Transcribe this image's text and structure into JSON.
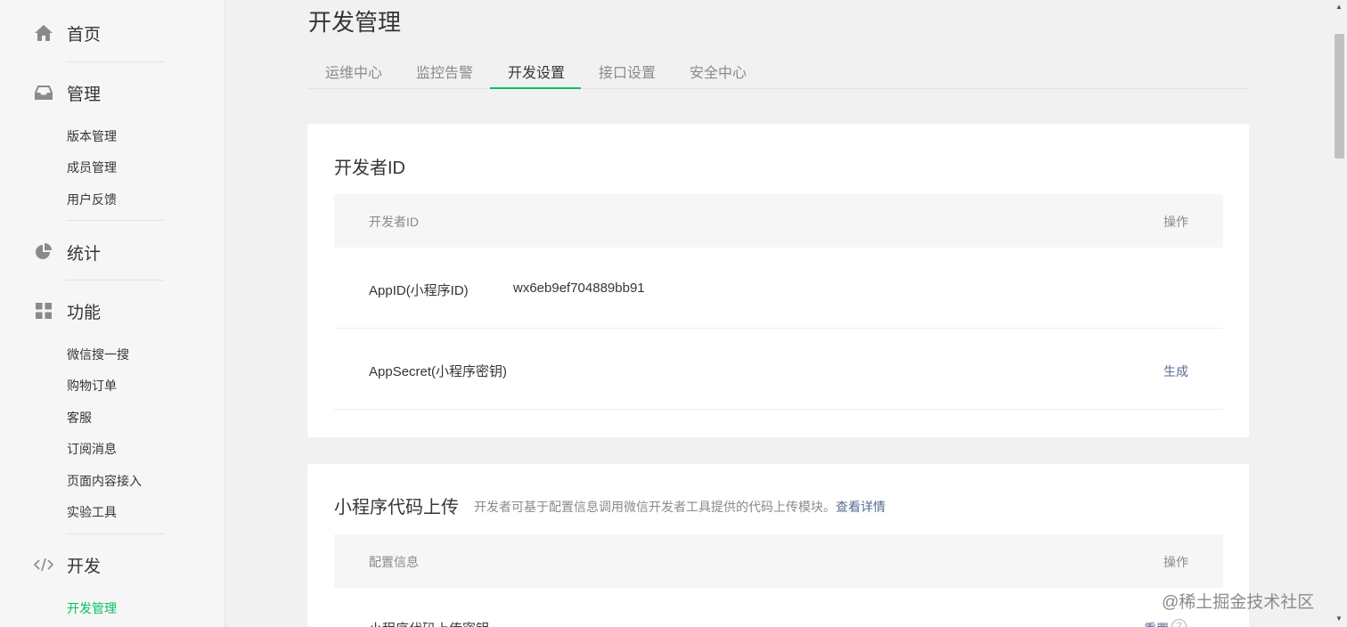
{
  "sidebar": {
    "home": "首页",
    "manage": "管理",
    "manage_items": [
      "版本管理",
      "成员管理",
      "用户反馈"
    ],
    "stats": "统计",
    "features": "功能",
    "feature_items": [
      "微信搜一搜",
      "购物订单",
      "客服",
      "订阅消息",
      "页面内容接入",
      "实验工具"
    ],
    "dev": "开发",
    "dev_items": [
      "开发管理"
    ]
  },
  "main": {
    "title": "开发管理",
    "tabs": [
      "运维中心",
      "监控告警",
      "开发设置",
      "接口设置",
      "安全中心"
    ],
    "active_tab": "开发设置",
    "developer_id": {
      "title": "开发者ID",
      "col_name": "开发者ID",
      "col_action": "操作",
      "rows": [
        {
          "label": "AppID(小程序ID)",
          "value": "wx6eb9ef704889bb91",
          "action": ""
        },
        {
          "label": "AppSecret(小程序密钥)",
          "value": "",
          "action": "生成"
        }
      ]
    },
    "upload": {
      "title": "小程序代码上传",
      "desc": "开发者可基于配置信息调用微信开发者工具提供的代码上传模块。",
      "desc_link": "查看详情",
      "col_name": "配置信息",
      "col_action": "操作",
      "row_label": "小程序代码上传密钥",
      "row_action": "重置"
    }
  },
  "watermark": "@稀土掘金技术社区",
  "colors": {
    "accent": "#07c160",
    "link": "#576b95",
    "muted": "#8a8a8a"
  }
}
